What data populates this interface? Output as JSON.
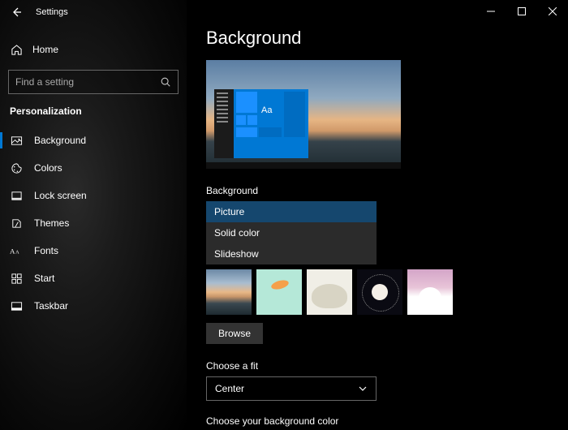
{
  "window": {
    "title": "Settings"
  },
  "home": {
    "label": "Home"
  },
  "search": {
    "placeholder": "Find a setting"
  },
  "category": "Personalization",
  "nav": {
    "items": [
      {
        "label": "Background"
      },
      {
        "label": "Colors"
      },
      {
        "label": "Lock screen"
      },
      {
        "label": "Themes"
      },
      {
        "label": "Fonts"
      },
      {
        "label": "Start"
      },
      {
        "label": "Taskbar"
      }
    ],
    "selected_index": 0
  },
  "page": {
    "heading": "Background",
    "preview": {
      "sample_text": "Aa"
    },
    "background_section": {
      "label": "Background",
      "dropdown": {
        "options": [
          "Picture",
          "Solid color",
          "Slideshow"
        ],
        "selected": "Picture"
      },
      "browse_label": "Browse"
    },
    "fit_section": {
      "label": "Choose a fit",
      "value": "Center"
    },
    "color_section": {
      "label": "Choose your background color"
    }
  }
}
